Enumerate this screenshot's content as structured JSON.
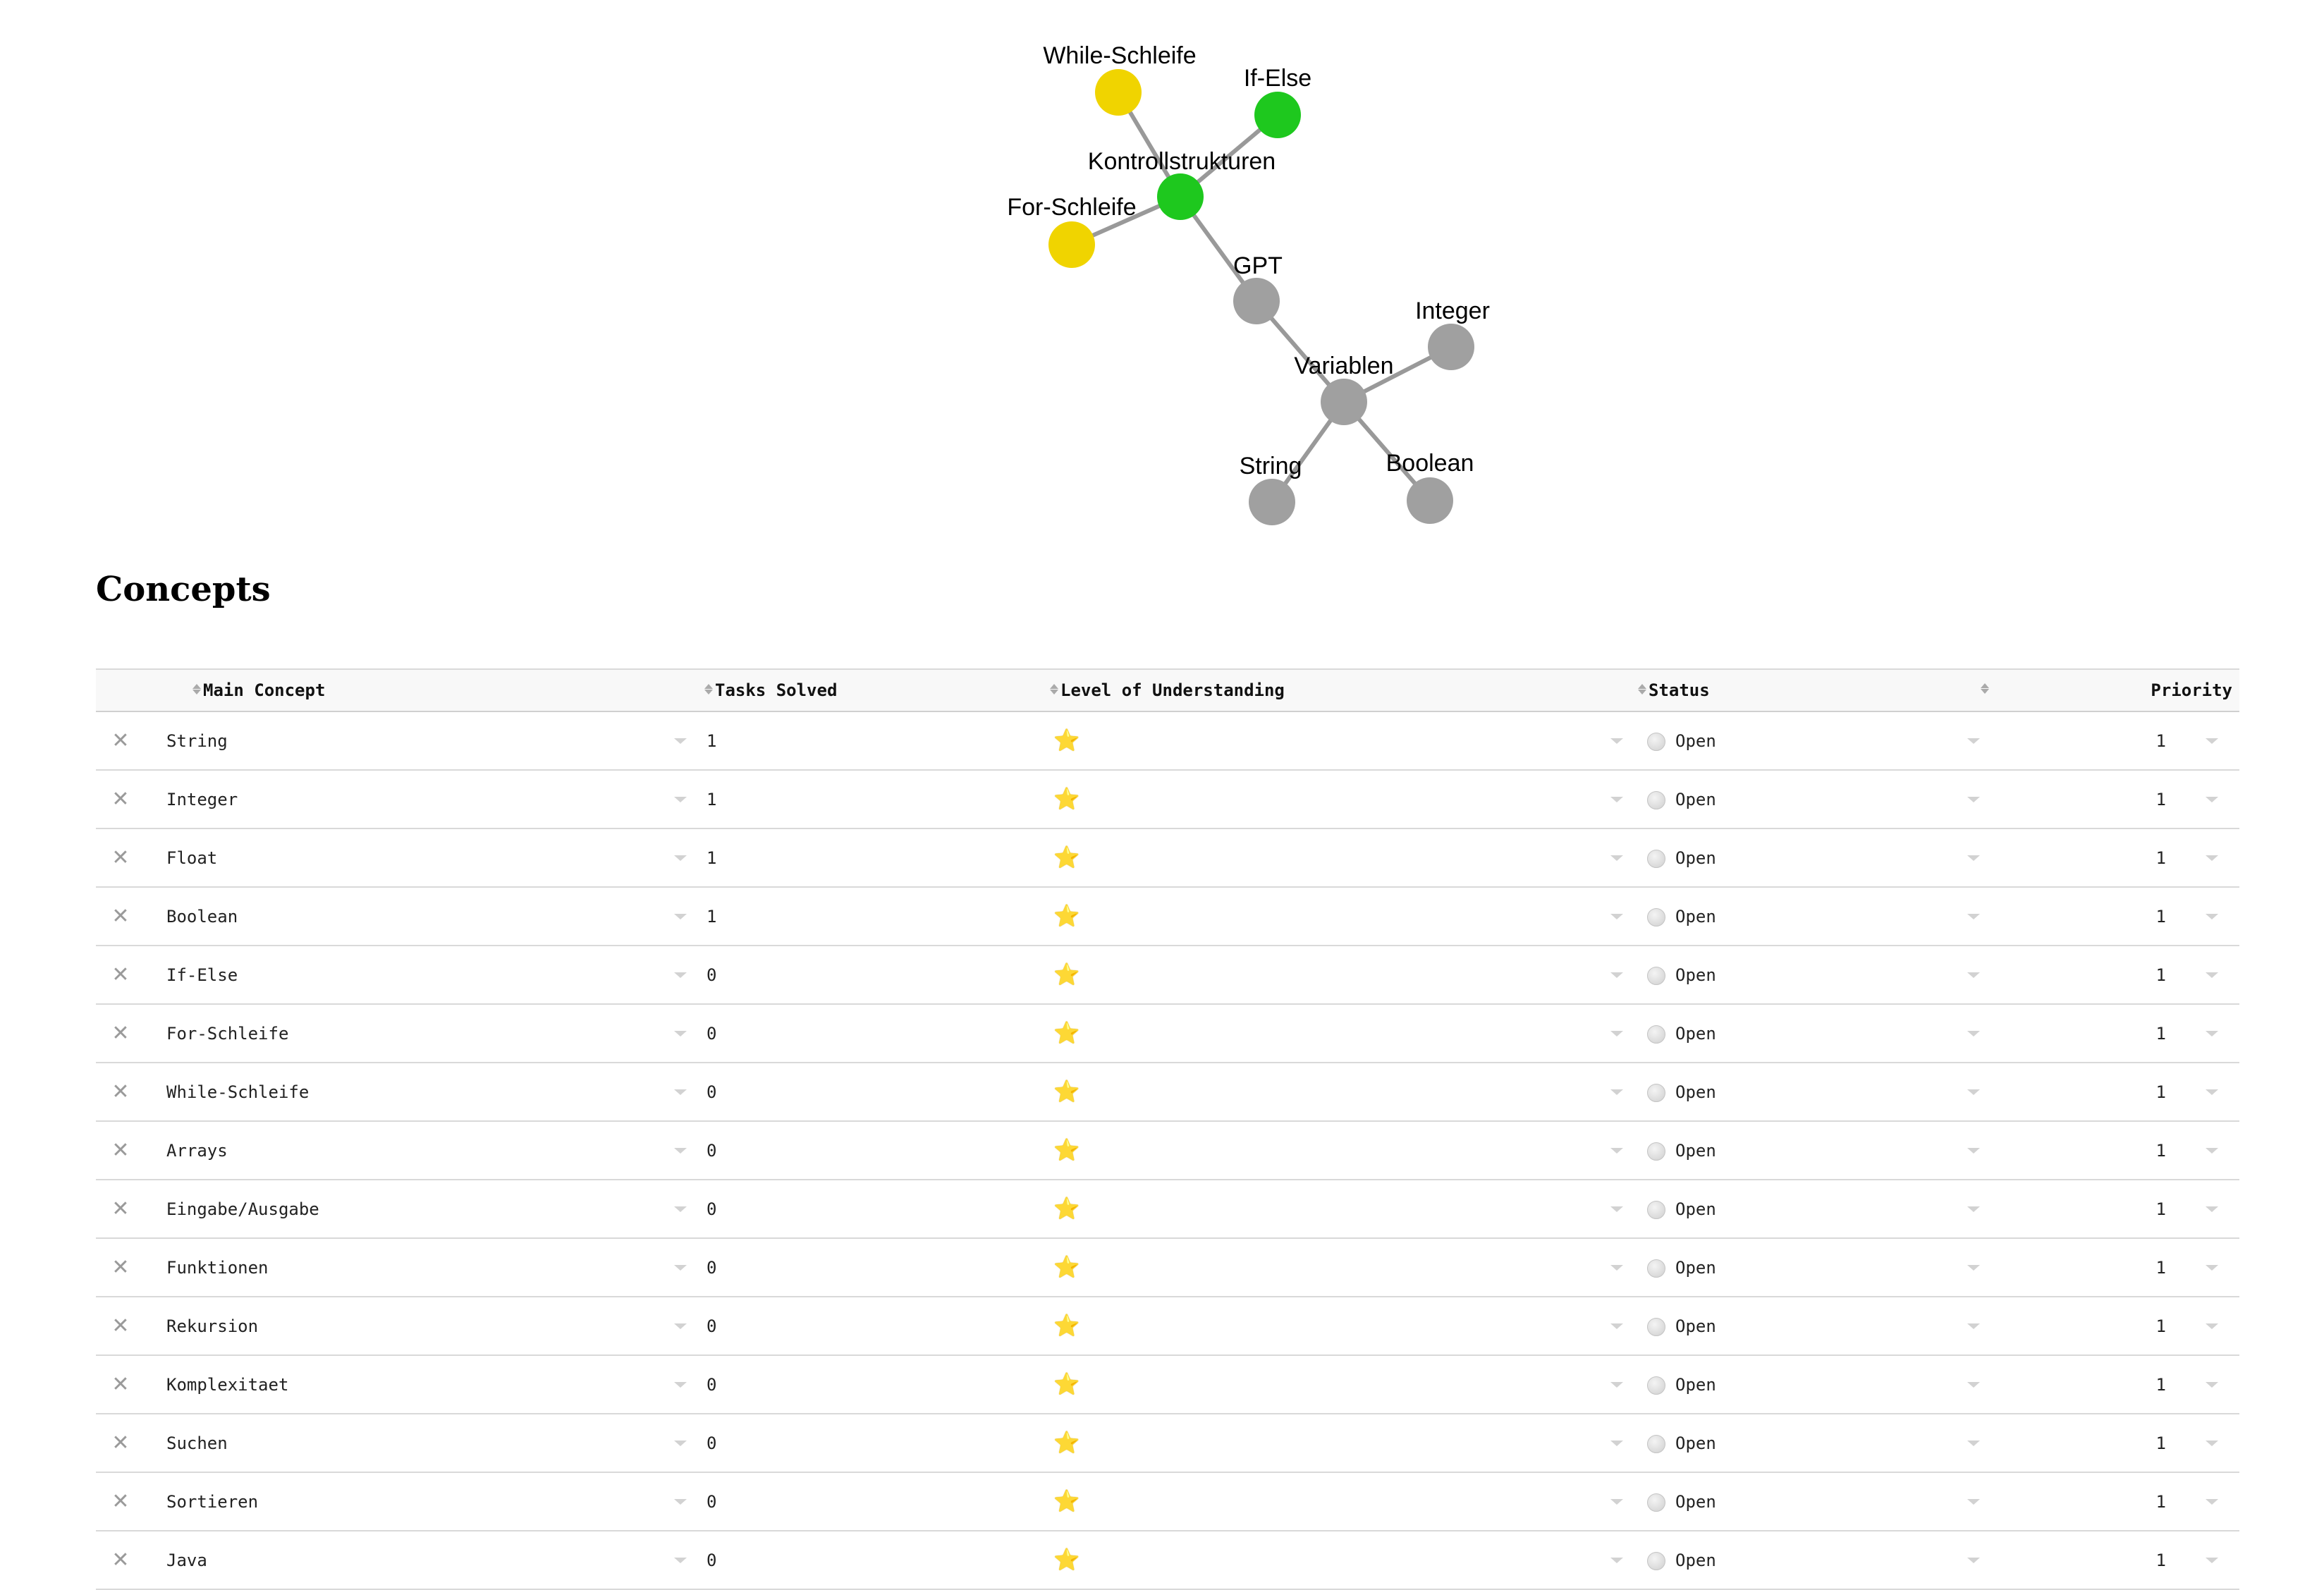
{
  "graph": {
    "edge_color": "#999999",
    "nodes": [
      {
        "id": "while",
        "label": "While-Schleife",
        "color": "#f0d400"
      },
      {
        "id": "ifelse",
        "label": "If-Else",
        "color": "#1ec81e"
      },
      {
        "id": "kontroll",
        "label": "Kontrollstrukturen",
        "color": "#1ec81e"
      },
      {
        "id": "for",
        "label": "For-Schleife",
        "color": "#f0d400"
      },
      {
        "id": "gpt",
        "label": "GPT",
        "color": "#a0a0a0"
      },
      {
        "id": "integer",
        "label": "Integer",
        "color": "#a0a0a0"
      },
      {
        "id": "variablen",
        "label": "Variablen",
        "color": "#a0a0a0"
      },
      {
        "id": "string",
        "label": "String",
        "color": "#a0a0a0"
      },
      {
        "id": "boolean",
        "label": "Boolean",
        "color": "#a0a0a0"
      }
    ],
    "edges": [
      [
        "while",
        "kontroll"
      ],
      [
        "ifelse",
        "kontroll"
      ],
      [
        "for",
        "kontroll"
      ],
      [
        "kontroll",
        "gpt"
      ],
      [
        "gpt",
        "variablen"
      ],
      [
        "variablen",
        "integer"
      ],
      [
        "variablen",
        "string"
      ],
      [
        "variablen",
        "boolean"
      ]
    ]
  },
  "section": {
    "title": "Concepts"
  },
  "table": {
    "headers": {
      "main_concept": "Main Concept",
      "tasks_solved": "Tasks Solved",
      "level": "Level of Understanding",
      "status": "Status",
      "priority": "Priority"
    },
    "rows": [
      {
        "concept": "String",
        "tasks": "1",
        "level": "⭐",
        "status": "Open",
        "priority": "1"
      },
      {
        "concept": "Integer",
        "tasks": "1",
        "level": "⭐",
        "status": "Open",
        "priority": "1"
      },
      {
        "concept": "Float",
        "tasks": "1",
        "level": "⭐",
        "status": "Open",
        "priority": "1"
      },
      {
        "concept": "Boolean",
        "tasks": "1",
        "level": "⭐",
        "status": "Open",
        "priority": "1"
      },
      {
        "concept": "If-Else",
        "tasks": "0",
        "level": "⭐",
        "status": "Open",
        "priority": "1"
      },
      {
        "concept": "For-Schleife",
        "tasks": "0",
        "level": "⭐",
        "status": "Open",
        "priority": "1"
      },
      {
        "concept": "While-Schleife",
        "tasks": "0",
        "level": "⭐",
        "status": "Open",
        "priority": "1"
      },
      {
        "concept": "Arrays",
        "tasks": "0",
        "level": "⭐",
        "status": "Open",
        "priority": "1"
      },
      {
        "concept": "Eingabe/Ausgabe",
        "tasks": "0",
        "level": "⭐",
        "status": "Open",
        "priority": "1"
      },
      {
        "concept": "Funktionen",
        "tasks": "0",
        "level": "⭐",
        "status": "Open",
        "priority": "1"
      },
      {
        "concept": "Rekursion",
        "tasks": "0",
        "level": "⭐",
        "status": "Open",
        "priority": "1"
      },
      {
        "concept": "Komplexitaet",
        "tasks": "0",
        "level": "⭐",
        "status": "Open",
        "priority": "1"
      },
      {
        "concept": "Suchen",
        "tasks": "0",
        "level": "⭐",
        "status": "Open",
        "priority": "1"
      },
      {
        "concept": "Sortieren",
        "tasks": "0",
        "level": "⭐",
        "status": "Open",
        "priority": "1"
      },
      {
        "concept": "Java",
        "tasks": "0",
        "level": "⭐",
        "status": "Open",
        "priority": "1"
      }
    ],
    "icons": {
      "delete": "close-icon",
      "dropdown": "chevron-down-icon",
      "sort": "sort-icon",
      "status": "status-dot-icon"
    },
    "delete_glyph": "✕"
  }
}
